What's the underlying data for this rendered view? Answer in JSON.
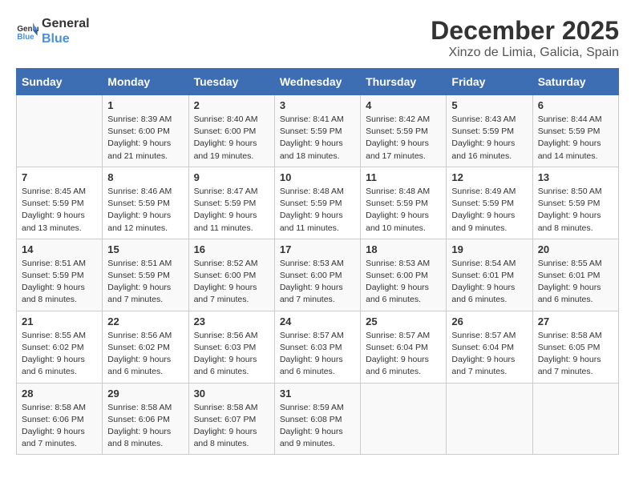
{
  "header": {
    "logo_general": "General",
    "logo_blue": "Blue",
    "month": "December 2025",
    "location": "Xinzo de Limia, Galicia, Spain"
  },
  "days_of_week": [
    "Sunday",
    "Monday",
    "Tuesday",
    "Wednesday",
    "Thursday",
    "Friday",
    "Saturday"
  ],
  "weeks": [
    [
      {
        "day": "",
        "info": ""
      },
      {
        "day": "1",
        "info": "Sunrise: 8:39 AM\nSunset: 6:00 PM\nDaylight: 9 hours\nand 21 minutes."
      },
      {
        "day": "2",
        "info": "Sunrise: 8:40 AM\nSunset: 6:00 PM\nDaylight: 9 hours\nand 19 minutes."
      },
      {
        "day": "3",
        "info": "Sunrise: 8:41 AM\nSunset: 5:59 PM\nDaylight: 9 hours\nand 18 minutes."
      },
      {
        "day": "4",
        "info": "Sunrise: 8:42 AM\nSunset: 5:59 PM\nDaylight: 9 hours\nand 17 minutes."
      },
      {
        "day": "5",
        "info": "Sunrise: 8:43 AM\nSunset: 5:59 PM\nDaylight: 9 hours\nand 16 minutes."
      },
      {
        "day": "6",
        "info": "Sunrise: 8:44 AM\nSunset: 5:59 PM\nDaylight: 9 hours\nand 14 minutes."
      }
    ],
    [
      {
        "day": "7",
        "info": "Sunrise: 8:45 AM\nSunset: 5:59 PM\nDaylight: 9 hours\nand 13 minutes."
      },
      {
        "day": "8",
        "info": "Sunrise: 8:46 AM\nSunset: 5:59 PM\nDaylight: 9 hours\nand 12 minutes."
      },
      {
        "day": "9",
        "info": "Sunrise: 8:47 AM\nSunset: 5:59 PM\nDaylight: 9 hours\nand 11 minutes."
      },
      {
        "day": "10",
        "info": "Sunrise: 8:48 AM\nSunset: 5:59 PM\nDaylight: 9 hours\nand 11 minutes."
      },
      {
        "day": "11",
        "info": "Sunrise: 8:48 AM\nSunset: 5:59 PM\nDaylight: 9 hours\nand 10 minutes."
      },
      {
        "day": "12",
        "info": "Sunrise: 8:49 AM\nSunset: 5:59 PM\nDaylight: 9 hours\nand 9 minutes."
      },
      {
        "day": "13",
        "info": "Sunrise: 8:50 AM\nSunset: 5:59 PM\nDaylight: 9 hours\nand 8 minutes."
      }
    ],
    [
      {
        "day": "14",
        "info": "Sunrise: 8:51 AM\nSunset: 5:59 PM\nDaylight: 9 hours\nand 8 minutes."
      },
      {
        "day": "15",
        "info": "Sunrise: 8:51 AM\nSunset: 5:59 PM\nDaylight: 9 hours\nand 7 minutes."
      },
      {
        "day": "16",
        "info": "Sunrise: 8:52 AM\nSunset: 6:00 PM\nDaylight: 9 hours\nand 7 minutes."
      },
      {
        "day": "17",
        "info": "Sunrise: 8:53 AM\nSunset: 6:00 PM\nDaylight: 9 hours\nand 7 minutes."
      },
      {
        "day": "18",
        "info": "Sunrise: 8:53 AM\nSunset: 6:00 PM\nDaylight: 9 hours\nand 6 minutes."
      },
      {
        "day": "19",
        "info": "Sunrise: 8:54 AM\nSunset: 6:01 PM\nDaylight: 9 hours\nand 6 minutes."
      },
      {
        "day": "20",
        "info": "Sunrise: 8:55 AM\nSunset: 6:01 PM\nDaylight: 9 hours\nand 6 minutes."
      }
    ],
    [
      {
        "day": "21",
        "info": "Sunrise: 8:55 AM\nSunset: 6:02 PM\nDaylight: 9 hours\nand 6 minutes."
      },
      {
        "day": "22",
        "info": "Sunrise: 8:56 AM\nSunset: 6:02 PM\nDaylight: 9 hours\nand 6 minutes."
      },
      {
        "day": "23",
        "info": "Sunrise: 8:56 AM\nSunset: 6:03 PM\nDaylight: 9 hours\nand 6 minutes."
      },
      {
        "day": "24",
        "info": "Sunrise: 8:57 AM\nSunset: 6:03 PM\nDaylight: 9 hours\nand 6 minutes."
      },
      {
        "day": "25",
        "info": "Sunrise: 8:57 AM\nSunset: 6:04 PM\nDaylight: 9 hours\nand 6 minutes."
      },
      {
        "day": "26",
        "info": "Sunrise: 8:57 AM\nSunset: 6:04 PM\nDaylight: 9 hours\nand 7 minutes."
      },
      {
        "day": "27",
        "info": "Sunrise: 8:58 AM\nSunset: 6:05 PM\nDaylight: 9 hours\nand 7 minutes."
      }
    ],
    [
      {
        "day": "28",
        "info": "Sunrise: 8:58 AM\nSunset: 6:06 PM\nDaylight: 9 hours\nand 7 minutes."
      },
      {
        "day": "29",
        "info": "Sunrise: 8:58 AM\nSunset: 6:06 PM\nDaylight: 9 hours\nand 8 minutes."
      },
      {
        "day": "30",
        "info": "Sunrise: 8:58 AM\nSunset: 6:07 PM\nDaylight: 9 hours\nand 8 minutes."
      },
      {
        "day": "31",
        "info": "Sunrise: 8:59 AM\nSunset: 6:08 PM\nDaylight: 9 hours\nand 9 minutes."
      },
      {
        "day": "",
        "info": ""
      },
      {
        "day": "",
        "info": ""
      },
      {
        "day": "",
        "info": ""
      }
    ]
  ]
}
